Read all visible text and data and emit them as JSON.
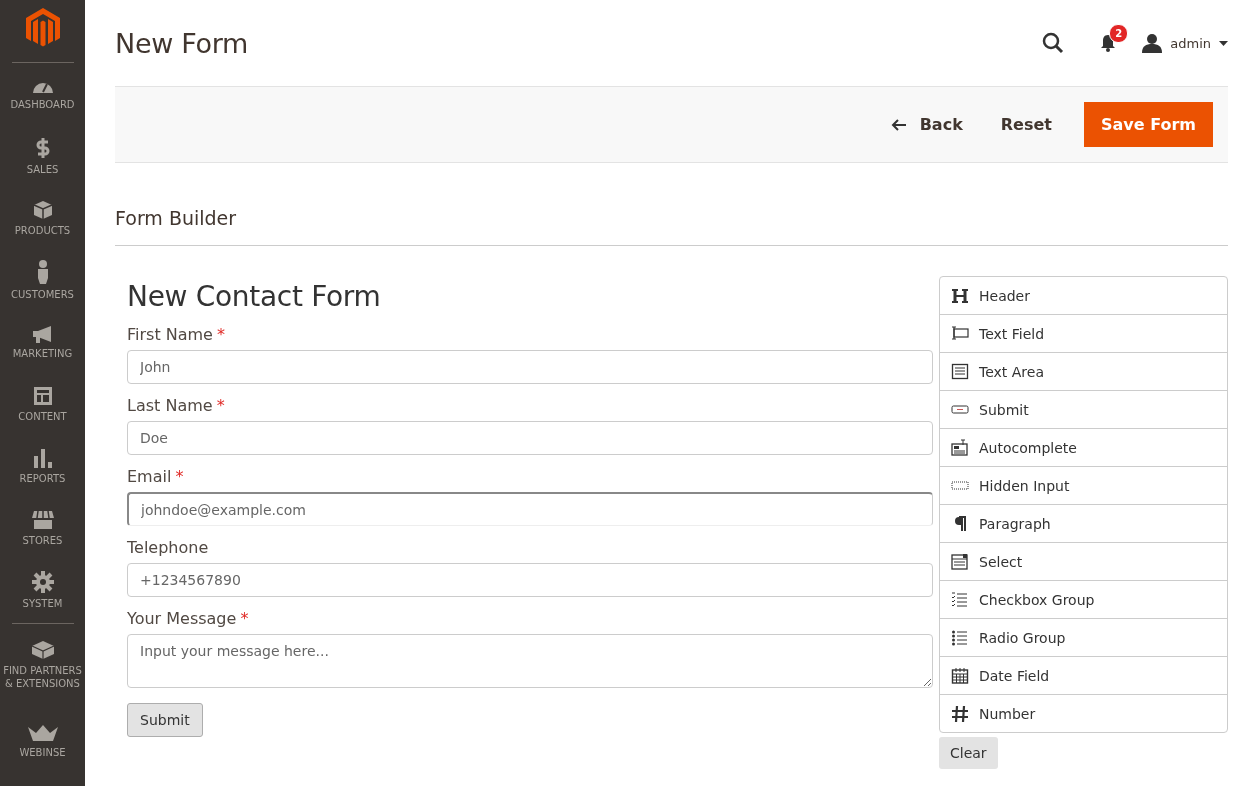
{
  "sidebar": {
    "items": [
      {
        "kind": "dashboard",
        "label": "DASHBOARD"
      },
      {
        "kind": "sales",
        "label": "SALES"
      },
      {
        "kind": "products",
        "label": "PRODUCTS"
      },
      {
        "kind": "customers",
        "label": "CUSTOMERS"
      },
      {
        "kind": "marketing",
        "label": "MARKETING"
      },
      {
        "kind": "content",
        "label": "CONTENT"
      },
      {
        "kind": "reports",
        "label": "REPORTS"
      },
      {
        "kind": "stores",
        "label": "STORES"
      },
      {
        "kind": "system",
        "label": "SYSTEM"
      },
      {
        "kind": "partners",
        "label": "FIND PARTNERS & EXTENSIONS"
      },
      {
        "kind": "webinse",
        "label": "WEBINSE"
      }
    ]
  },
  "header": {
    "title": "New Form",
    "notification_count": "2",
    "user": "admin"
  },
  "actions": {
    "back": "Back",
    "reset": "Reset",
    "save": "Save Form"
  },
  "section_title": "Form Builder",
  "form": {
    "title": "New Contact Form",
    "fields": [
      {
        "kind": "input",
        "label": "First Name",
        "required_mark": "*",
        "placeholder": "John",
        "focused": false
      },
      {
        "kind": "input",
        "label": "Last Name",
        "required_mark": "*",
        "placeholder": "Doe",
        "focused": false
      },
      {
        "kind": "input",
        "label": "Email",
        "required_mark": "*",
        "placeholder": "johndoe@example.com",
        "focused": true
      },
      {
        "kind": "input",
        "label": "Telephone",
        "placeholder": "+1234567890",
        "focused": false
      },
      {
        "kind": "textarea",
        "label": "Your Message",
        "required_mark": "*",
        "placeholder": "Input your message here...",
        "focused": false
      }
    ],
    "submit": "Submit"
  },
  "palette": {
    "items": [
      {
        "kind": "header",
        "label": "Header"
      },
      {
        "kind": "text-field",
        "label": "Text Field"
      },
      {
        "kind": "text-area",
        "label": "Text Area"
      },
      {
        "kind": "submit",
        "label": "Submit"
      },
      {
        "kind": "autocomplete",
        "label": "Autocomplete"
      },
      {
        "kind": "hidden",
        "label": "Hidden Input"
      },
      {
        "kind": "paragraph",
        "label": "Paragraph"
      },
      {
        "kind": "select",
        "label": "Select"
      },
      {
        "kind": "checkbox",
        "label": "Checkbox Group"
      },
      {
        "kind": "radio",
        "label": "Radio Group"
      },
      {
        "kind": "date",
        "label": "Date Field"
      },
      {
        "kind": "number",
        "label": "Number"
      }
    ],
    "clear": "Clear"
  }
}
